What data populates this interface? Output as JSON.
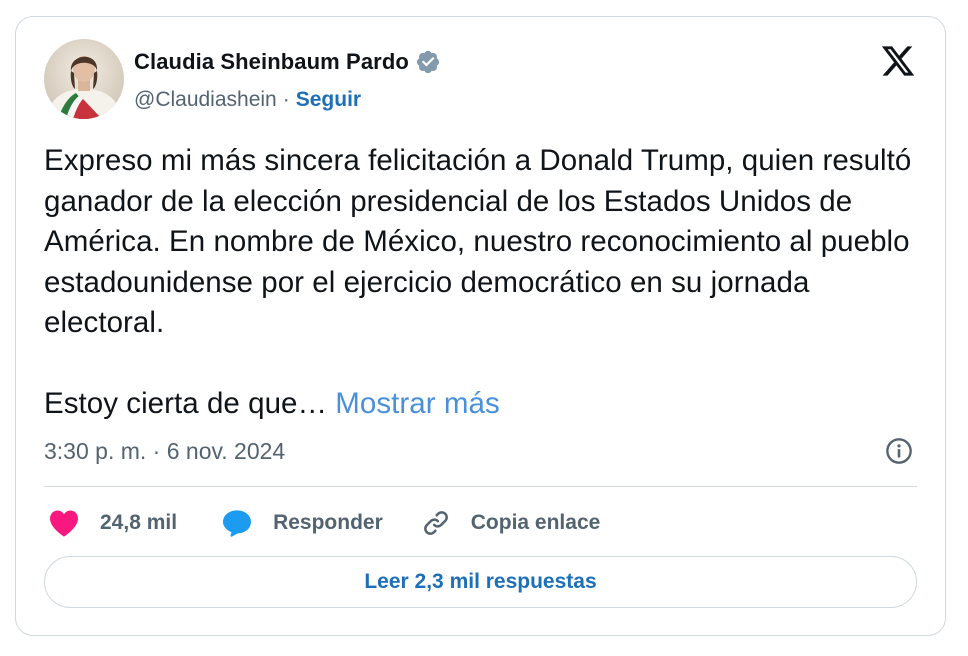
{
  "author": {
    "display_name": "Claudia Sheinbaum Pardo",
    "handle": "@Claudiashein",
    "separator": "·",
    "follow_label": "Seguir",
    "verified": true
  },
  "tweet": {
    "paragraph1": "Expreso mi más sincera felicitación a Donald Trump, quien resultó ganador de la elección presidencial de los Estados Unidos de América. En nombre de México, nuestro reconocimiento al pueblo estadounidense por el ejercicio democrático en su jornada electoral.",
    "paragraph2": "Estoy cierta de que…",
    "show_more": "Mostrar más",
    "timestamp": "3:30 p. m. · 6 nov. 2024"
  },
  "actions": {
    "likes": "24,8 mil",
    "reply_label": "Responder",
    "copy_link_label": "Copia enlace"
  },
  "read_replies_label": "Leer 2,3 mil respuestas",
  "icons": {
    "platform": "x-logo-icon",
    "verified": "verified-badge-icon",
    "info": "info-icon",
    "like": "heart-icon",
    "reply": "speech-bubble-icon",
    "copy": "link-icon"
  },
  "colors": {
    "link": "#1d6fb8",
    "show_more": "#4a90d9",
    "like": "#f91880",
    "reply": "#1d9bf0",
    "muted": "#536471",
    "border": "#cfd9de"
  }
}
